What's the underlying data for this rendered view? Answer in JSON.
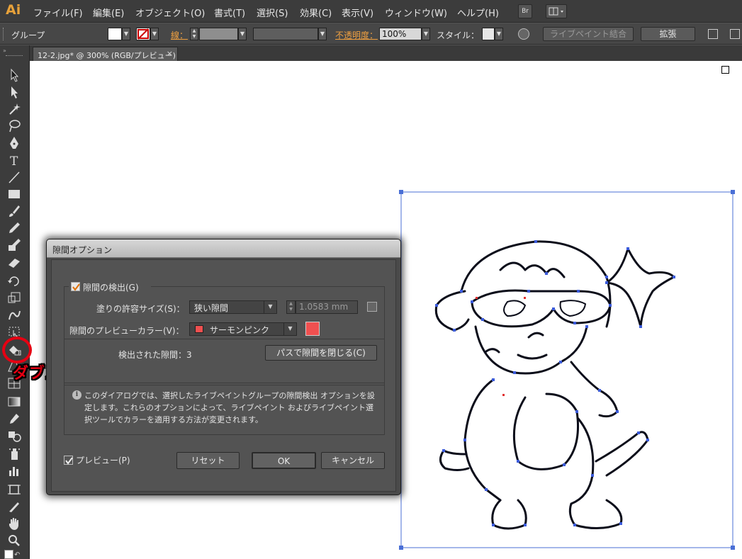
{
  "app": {
    "logo": "Ai"
  },
  "menubar": {
    "items": [
      "ファイル(F)",
      "編集(E)",
      "オブジェクト(O)",
      "書式(T)",
      "選択(S)",
      "効果(C)",
      "表示(V)",
      "ウィンドウ(W)",
      "ヘルプ(H)"
    ],
    "bridge_label": "Br"
  },
  "controlbar": {
    "selection_label": "グループ",
    "stroke_label": "線：",
    "opacity_label": "不透明度：",
    "opacity_value": "100%",
    "style_label": "スタイル：",
    "livepaint_merge": "ライブペイント結合",
    "expand": "拡張"
  },
  "document_tab": {
    "title": "12-2.jpg* @ 300% (RGB/プレビュー)",
    "close": "×"
  },
  "annotation": {
    "text": "ダブルクリック",
    "color": "#e60012"
  },
  "dialog": {
    "title": "隙間オプション",
    "gap_detection": {
      "label": "隙間の検出(G)",
      "checked": true
    },
    "fill_tolerance": {
      "label": "塗りの許容サイズ(S)：",
      "value": "狭い隙間",
      "size": "1.0583 mm"
    },
    "preview_color": {
      "label": "隙間のプレビューカラー(V)：",
      "value": "サーモンピンク",
      "swatch": "#f05050"
    },
    "detected": {
      "label": "検出された隙間：3"
    },
    "close_gaps_button": "パスで隙間を閉じる(C)",
    "info": "このダイアログでは、選択したライブペイントグループの隙間検出 オプションを設定します。これらのオプションによって、ライブペイント およびライブペイント選択ツールでカラーを適用する方法が変更されます。",
    "preview": {
      "label": "プレビュー(P)",
      "checked": true
    },
    "reset_button": "リセット",
    "ok_button": "OK",
    "cancel_button": "キャンセル"
  },
  "colors": {
    "accent_orange": "#e8a23a",
    "selection_blue": "#3b5bdb"
  }
}
